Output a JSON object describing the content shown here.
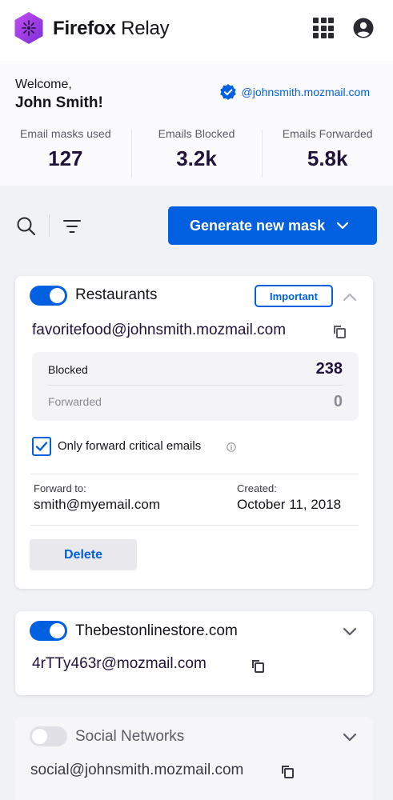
{
  "app": {
    "brand_bold": "Firefox",
    "brand_rest": " Relay"
  },
  "profile": {
    "welcome": "Welcome,",
    "name": "John Smith!",
    "relay_alias": "@johnsmith.mozmail.com"
  },
  "stats": [
    {
      "label": "Email masks used",
      "value": "127"
    },
    {
      "label": "Emails Blocked",
      "value": "3.2k"
    },
    {
      "label": "Emails Forwarded",
      "value": "5.8k"
    }
  ],
  "toolbar": {
    "generate_label": "Generate new mask"
  },
  "masks": [
    {
      "label": "Restaurants",
      "enabled": true,
      "tag": "Important",
      "address": "favoritefood@johnsmith.mozmail.com",
      "blocked_label": "Blocked",
      "blocked_value": "238",
      "forwarded_label": "Forwarded",
      "forwarded_value": "0",
      "critical_label": "Only forward critical emails",
      "critical_checked": true,
      "forward_to_label": "Forward to:",
      "forward_to_value": "smith@myemail.com",
      "created_label": "Created:",
      "created_value": "October 11, 2018",
      "delete_label": "Delete"
    },
    {
      "label": "Thebestonlinestore.com",
      "enabled": true,
      "address": "4rTTy463r@mozmail.com"
    },
    {
      "label": "Social Networks",
      "enabled": false,
      "address": "social@johnsmith.mozmail.com"
    }
  ],
  "colors": {
    "primary": "#0060df",
    "logo": "#a140e8",
    "text": "#15141a"
  },
  "icons": [
    "relay-logo-icon",
    "apps-grid-icon",
    "account-icon",
    "verified-badge-icon",
    "search-icon",
    "filter-icon",
    "chevron-down-icon",
    "chevron-up-icon",
    "copy-icon",
    "checkmark-icon",
    "info-icon"
  ]
}
